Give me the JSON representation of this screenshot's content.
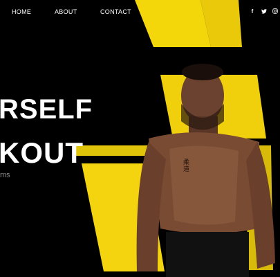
{
  "nav": {
    "items": [
      "HOME",
      "ABOUT",
      "CONTACT"
    ]
  },
  "social": {
    "icons": [
      "facebook-icon",
      "twitter-icon",
      "instagram-icon"
    ],
    "glyphs": [
      "f",
      "ᵂ",
      "◎"
    ]
  },
  "hero": {
    "headline_line1": "RSELF",
    "headline_line2": "KOUT",
    "subline": "ms",
    "tattoo": "柔\n道"
  },
  "colors": {
    "accent_yellow": "#f2d40c",
    "background": "#000000",
    "subline_gray": "#8a8a8a"
  }
}
